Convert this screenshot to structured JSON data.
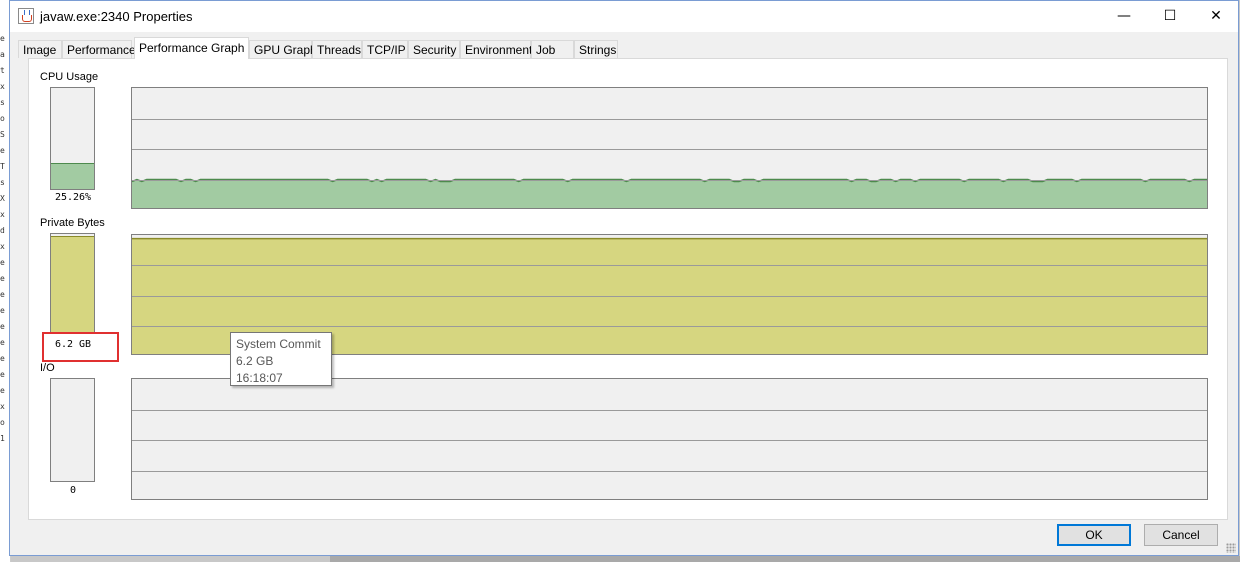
{
  "window": {
    "title": "javaw.exe:2340 Properties",
    "icon": "java-icon",
    "controls": {
      "minimize": "—",
      "maximize": "☐",
      "close": "✕"
    }
  },
  "tabs": [
    {
      "label": "Image",
      "active": false
    },
    {
      "label": "Performance",
      "active": false
    },
    {
      "label": "Performance Graph",
      "active": true
    },
    {
      "label": "GPU Graph",
      "active": false
    },
    {
      "label": "Threads",
      "active": false
    },
    {
      "label": "TCP/IP",
      "active": false
    },
    {
      "label": "Security",
      "active": false
    },
    {
      "label": "Environment",
      "active": false
    },
    {
      "label": "Job",
      "active": false
    },
    {
      "label": "Strings",
      "active": false
    }
  ],
  "graphs": {
    "cpu": {
      "label": "CPU Usage",
      "value": "25.26%",
      "level": 0.25,
      "color": "#a2cba2",
      "line": "#4d8a4d"
    },
    "private_bytes": {
      "label": "Private Bytes",
      "value": "6.2 GB",
      "level": 0.97,
      "color": "#d6d680",
      "line": "#8a8a2a"
    },
    "io": {
      "label": "I/O",
      "value": "0",
      "level": 0
    }
  },
  "tooltip": {
    "title": "System Commit",
    "value": "6.2 GB",
    "time": "16:18:07"
  },
  "buttons": {
    "ok": "OK",
    "cancel": "Cancel"
  },
  "highlight_color": "#e03030"
}
